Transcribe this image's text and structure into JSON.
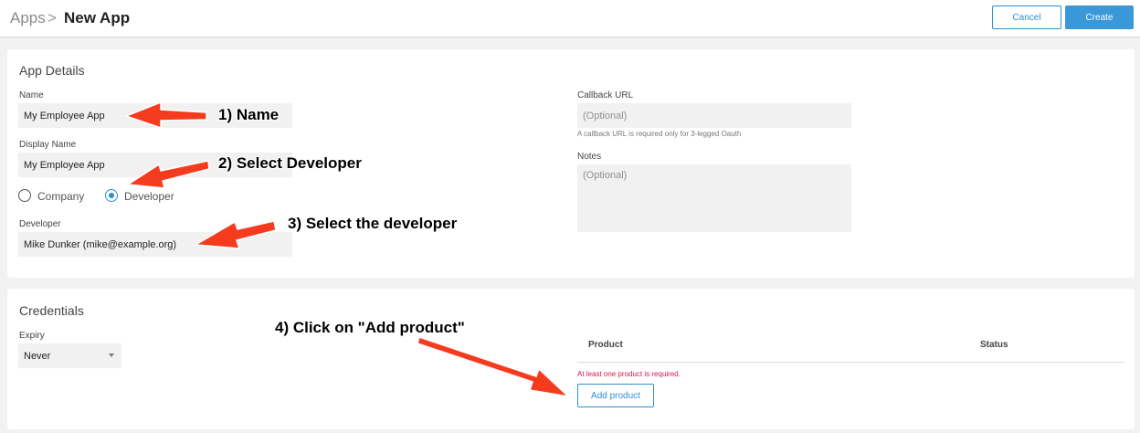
{
  "header": {
    "breadcrumb_root": "Apps",
    "breadcrumb_sep": ">",
    "title": "New App",
    "cancel_label": "Cancel",
    "create_label": "Create"
  },
  "app_details": {
    "section_title": "App Details",
    "name_label": "Name",
    "name_value": "My Employee App",
    "display_name_label": "Display Name",
    "display_name_value": "My Employee App",
    "owner_options": [
      {
        "label": "Company",
        "selected": false
      },
      {
        "label": "Developer",
        "selected": true
      }
    ],
    "developer_label": "Developer",
    "developer_value": "Mike Dunker (mike@example.org)",
    "callback_label": "Callback URL",
    "callback_placeholder": "(Optional)",
    "callback_help": "A callback URL is required only for 3-legged Oauth",
    "notes_label": "Notes",
    "notes_placeholder": "(Optional)"
  },
  "credentials": {
    "section_title": "Credentials",
    "expiry_label": "Expiry",
    "expiry_value": "Never",
    "table_headers": [
      "Product",
      "Status"
    ],
    "error_text": "At least one product is required.",
    "add_product_label": "Add product"
  },
  "annotations": {
    "step1": "1) Name",
    "step2": "2) Select Developer",
    "step3": "3) Select the developer",
    "step4": "4) Click on \"Add product\"",
    "arrow_color": "#f53b1e"
  },
  "colors": {
    "accent": "#2e8fd1",
    "error": "#d4145a"
  }
}
